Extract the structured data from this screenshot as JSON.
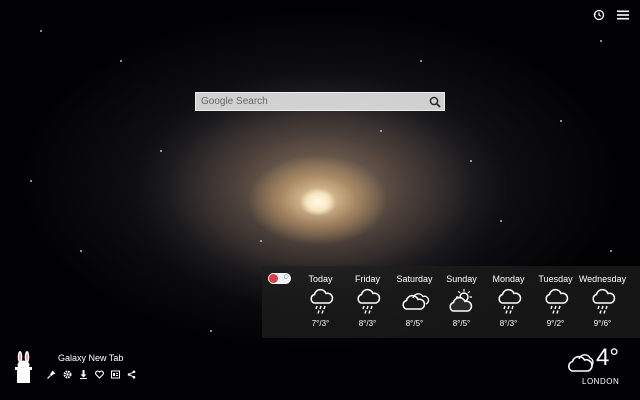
{
  "search": {
    "placeholder": "Google Search"
  },
  "top_icons": [
    "history-icon",
    "menu-icon"
  ],
  "weather": {
    "toggle_label": "C",
    "days": [
      {
        "name": "Today",
        "icon": "rain-icon",
        "temp": "7°/3°"
      },
      {
        "name": "Friday",
        "icon": "rain-icon",
        "temp": "8°/3°"
      },
      {
        "name": "Saturday",
        "icon": "cloudy-icon",
        "temp": "8°/5°"
      },
      {
        "name": "Sunday",
        "icon": "partly-cloudy-day-icon",
        "temp": "8°/5°"
      },
      {
        "name": "Monday",
        "icon": "rain-icon",
        "temp": "8°/3°"
      },
      {
        "name": "Tuesday",
        "icon": "rain-icon",
        "temp": "9°/2°"
      },
      {
        "name": "Wednesday",
        "icon": "rain-icon",
        "temp": "9°/6°"
      }
    ]
  },
  "brand": {
    "title": "Galaxy New Tab",
    "tools": [
      "pin-icon",
      "settings-icon",
      "download-icon",
      "heart-icon",
      "gallery-icon",
      "share-icon"
    ]
  },
  "current": {
    "temp": "4°",
    "city": "LONDON",
    "icon": "cloudy-icon"
  }
}
